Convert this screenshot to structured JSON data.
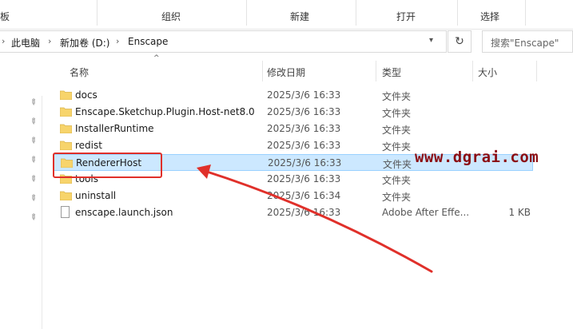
{
  "ribbon": {
    "groups": [
      "板",
      "组织",
      "新建",
      "打开",
      "选择"
    ]
  },
  "address": {
    "crumbs": [
      "此电脑",
      "新加卷 (D:)",
      "Enscape"
    ]
  },
  "search": {
    "placeholder": "搜索\"Enscape\""
  },
  "columns": {
    "name": "名称",
    "date": "修改日期",
    "type": "类型",
    "size": "大小"
  },
  "files": [
    {
      "name": "docs",
      "date": "2025/3/6 16:33",
      "type": "文件夹",
      "size": "",
      "kind": "folder-icon"
    },
    {
      "name": "Enscape.Sketchup.Plugin.Host-net8.0",
      "date": "2025/3/6 16:33",
      "type": "文件夹",
      "size": "",
      "kind": "folder-icon"
    },
    {
      "name": "InstallerRuntime",
      "date": "2025/3/6 16:33",
      "type": "文件夹",
      "size": "",
      "kind": "folder-icon"
    },
    {
      "name": "redist",
      "date": "2025/3/6 16:33",
      "type": "文件夹",
      "size": "",
      "kind": "folder-icon"
    },
    {
      "name": "RendererHost",
      "date": "2025/3/6 16:33",
      "type": "文件夹",
      "size": "",
      "kind": "folder-icon",
      "selected": true
    },
    {
      "name": "tools",
      "date": "2025/3/6 16:33",
      "type": "文件夹",
      "size": "",
      "kind": "folder-icon"
    },
    {
      "name": "uninstall",
      "date": "2025/3/6 16:34",
      "type": "文件夹",
      "size": "",
      "kind": "folder-icon"
    },
    {
      "name": "enscape.launch.json",
      "date": "2025/3/6 16:33",
      "type": "Adobe After Effe...",
      "size": "1 KB",
      "kind": "file-icon"
    }
  ],
  "watermark": "www.dgrai.com",
  "colors": {
    "selection": "#cce8ff",
    "highlight": "#e0302a",
    "folder": "#f7d46b",
    "watermark": "#8b0d12"
  }
}
